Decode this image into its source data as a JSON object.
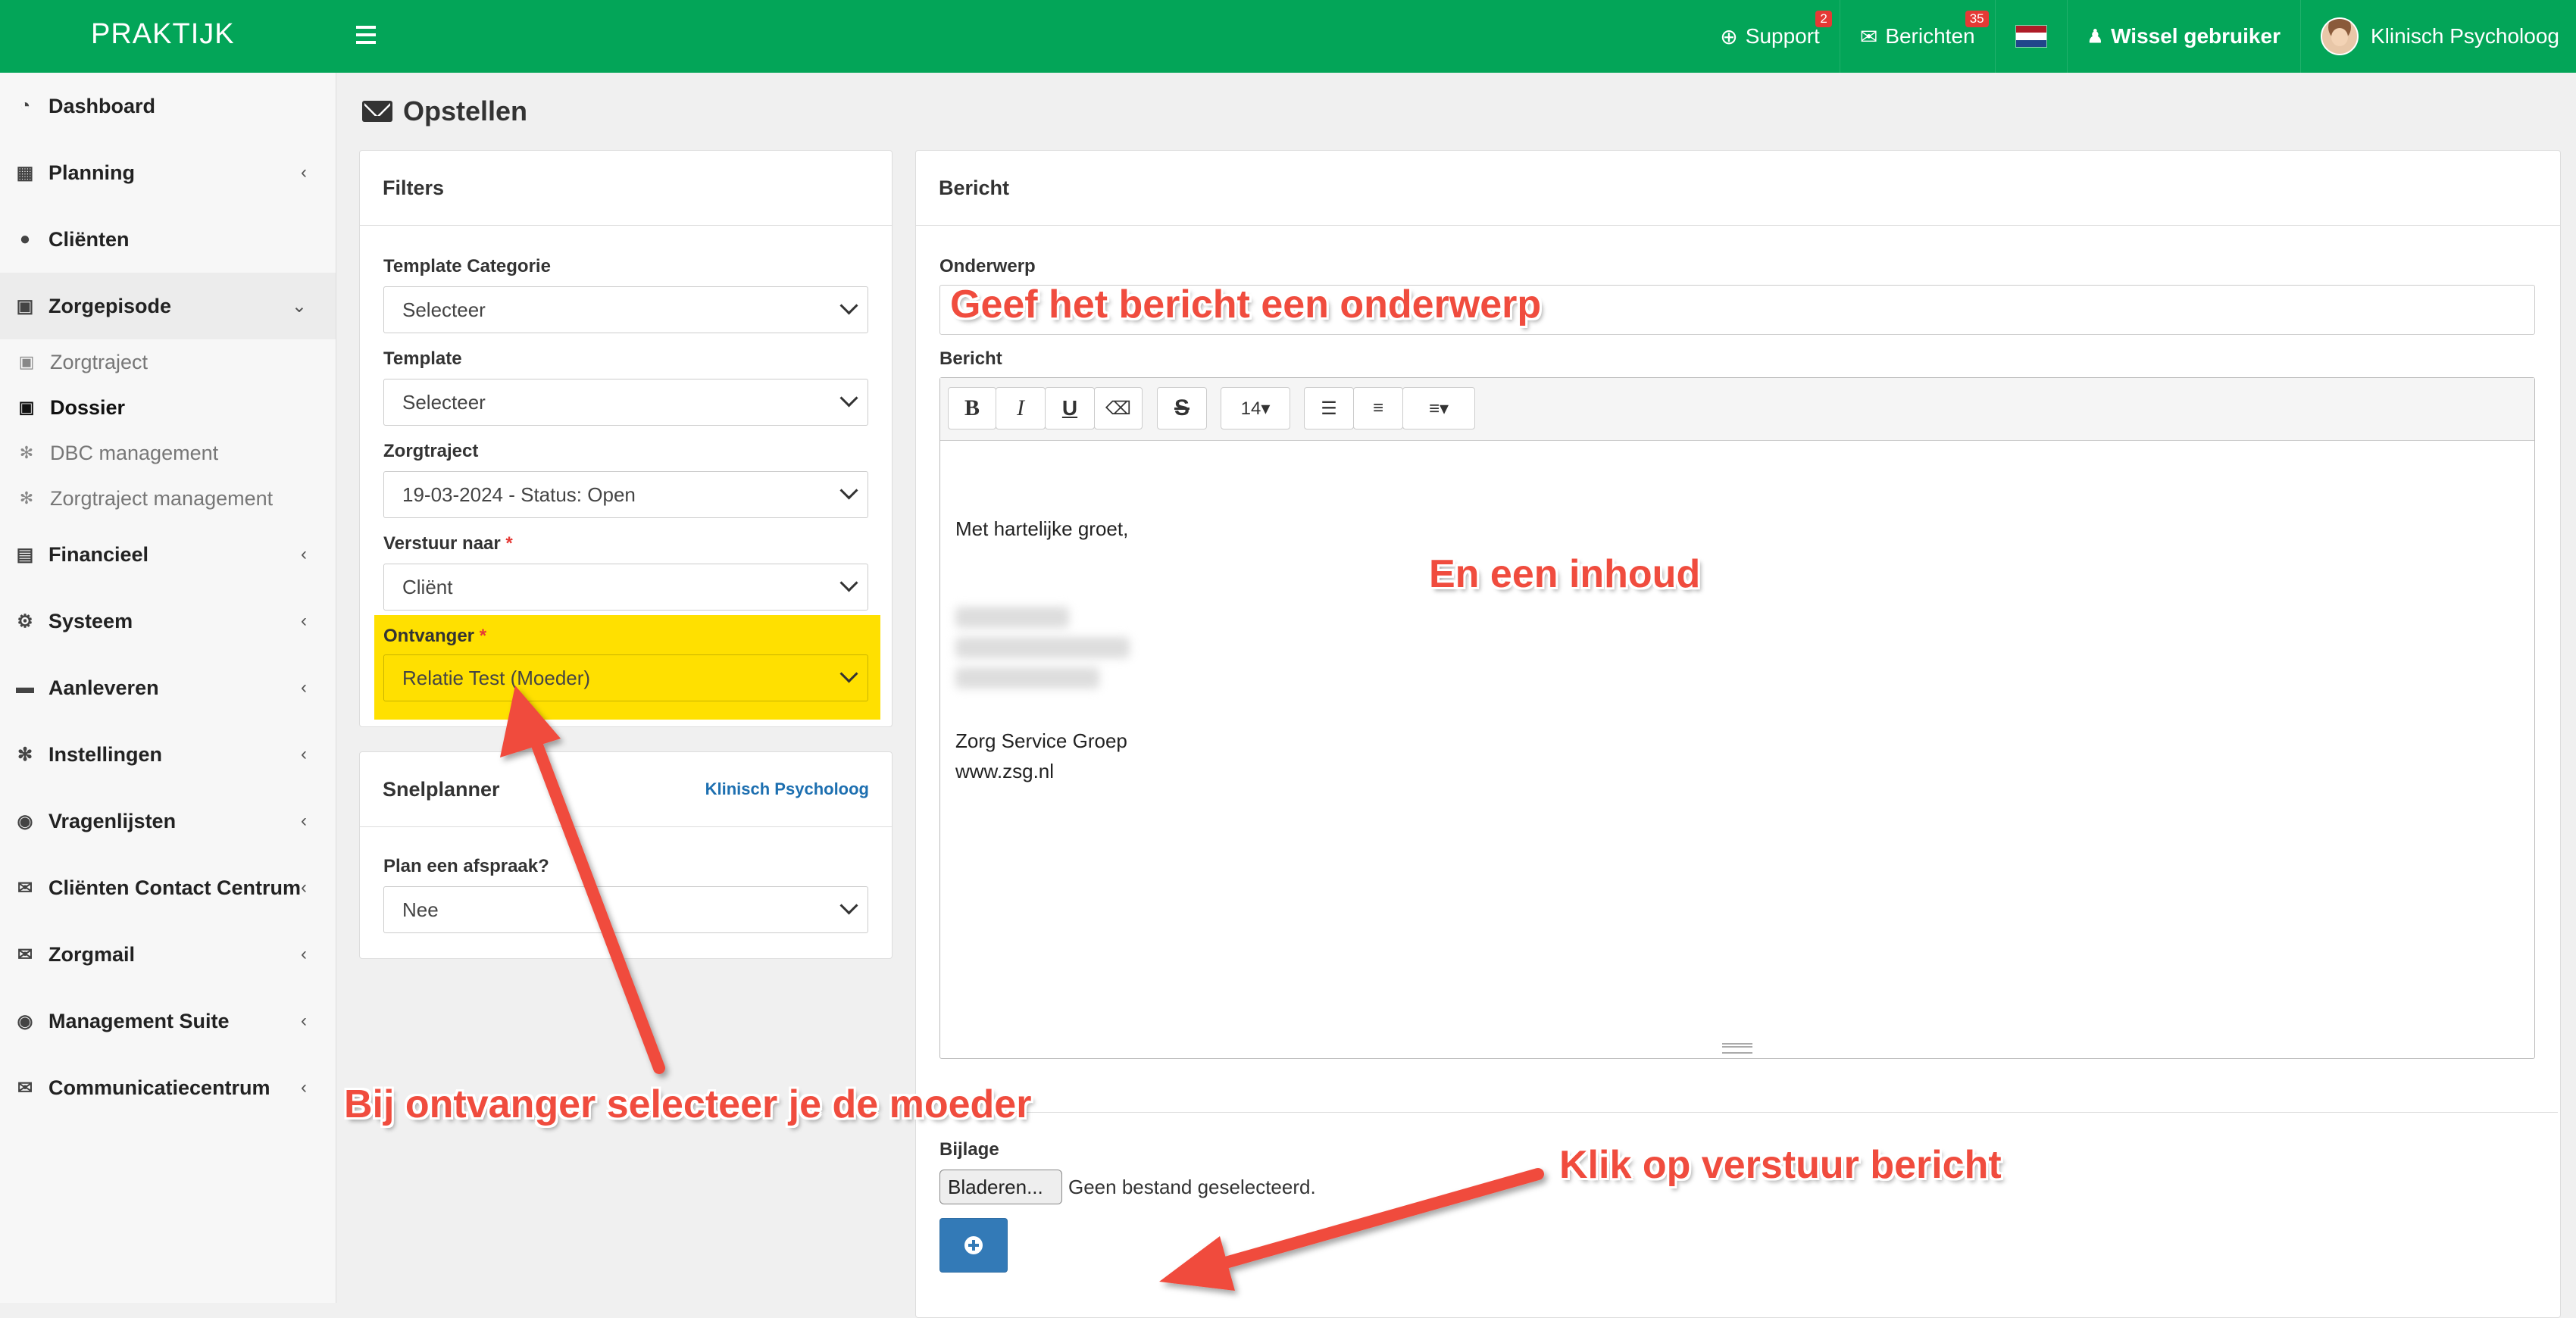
{
  "topbar": {
    "brand": "PRAKTIJK",
    "support": {
      "label": "Support",
      "badge": "2"
    },
    "berichten": {
      "label": "Berichten",
      "badge": "35"
    },
    "wissel": "Wissel gebruiker",
    "user": "Klinisch Psycholoog",
    "colors": {
      "bar": "#03a558",
      "badge": "#e53935"
    }
  },
  "sidebar": {
    "items": [
      {
        "label": "Dashboard",
        "icon": "dashboard-icon"
      },
      {
        "label": "Planning",
        "icon": "calendar-icon"
      },
      {
        "label": "Cliënten",
        "icon": "user-icon"
      },
      {
        "label": "Zorgepisode",
        "icon": "medkit-icon"
      },
      {
        "label": "Financieel",
        "icon": "book-icon"
      },
      {
        "label": "Systeem",
        "icon": "cogs-icon"
      },
      {
        "label": "Aanleveren",
        "icon": "truck-icon"
      },
      {
        "label": "Instellingen",
        "icon": "gear-icon"
      },
      {
        "label": "Vragenlijsten",
        "icon": "globe-icon"
      },
      {
        "label": "Cliënten Contact Centrum",
        "icon": "envelope-icon"
      },
      {
        "label": "Zorgmail",
        "icon": "envelope-icon"
      },
      {
        "label": "Management Suite",
        "icon": "globe-icon"
      },
      {
        "label": "Communicatiecentrum",
        "icon": "envelope-square-icon"
      }
    ],
    "subitems": [
      {
        "label": "Zorgtraject",
        "icon": "medkit-icon"
      },
      {
        "label": "Dossier",
        "icon": "medkit-icon"
      },
      {
        "label": "DBC management",
        "icon": "gear-icon"
      },
      {
        "label": "Zorgtraject management",
        "icon": "gear-icon"
      }
    ]
  },
  "page": {
    "title": "Opstellen"
  },
  "filters": {
    "title": "Filters",
    "template_categorie": {
      "label": "Template Categorie",
      "value": "Selecteer"
    },
    "template": {
      "label": "Template",
      "value": "Selecteer"
    },
    "zorgtraject": {
      "label": "Zorgtraject",
      "value": "19-03-2024 - Status: Open"
    },
    "verstuur_naar": {
      "label": "Verstuur naar",
      "value": "Cliënt"
    },
    "ontvanger": {
      "label": "Ontvanger",
      "value": "Relatie Test (Moeder)"
    },
    "required_mark": "*"
  },
  "snelplanner": {
    "title": "Snelplanner",
    "link": "Klinisch Psycholoog",
    "plan": {
      "label": "Plan een afspraak?",
      "value": "Nee"
    }
  },
  "bericht": {
    "title": "Bericht",
    "onderwerp_label": "Onderwerp",
    "bericht_label": "Bericht",
    "toolbar": {
      "bold": "B",
      "italic": "I",
      "underline": "U",
      "strike": "S",
      "fontsize": "14▾"
    },
    "body": {
      "greeting": "Met hartelijke groet,",
      "org": "Zorg Service Groep",
      "url": "www.zsg.nl"
    },
    "bijlage_label": "Bijlage",
    "browse": "Bladeren...",
    "no_file": "Geen bestand geselecteerd."
  },
  "annotations": {
    "onderwerp": "Geef het bericht een onderwerp",
    "inhoud": "En een inhoud",
    "ontvanger": "Bij ontvanger selecteer je de moeder",
    "verstuur": "Klik op verstuur bericht",
    "color": "#f04c3e"
  }
}
